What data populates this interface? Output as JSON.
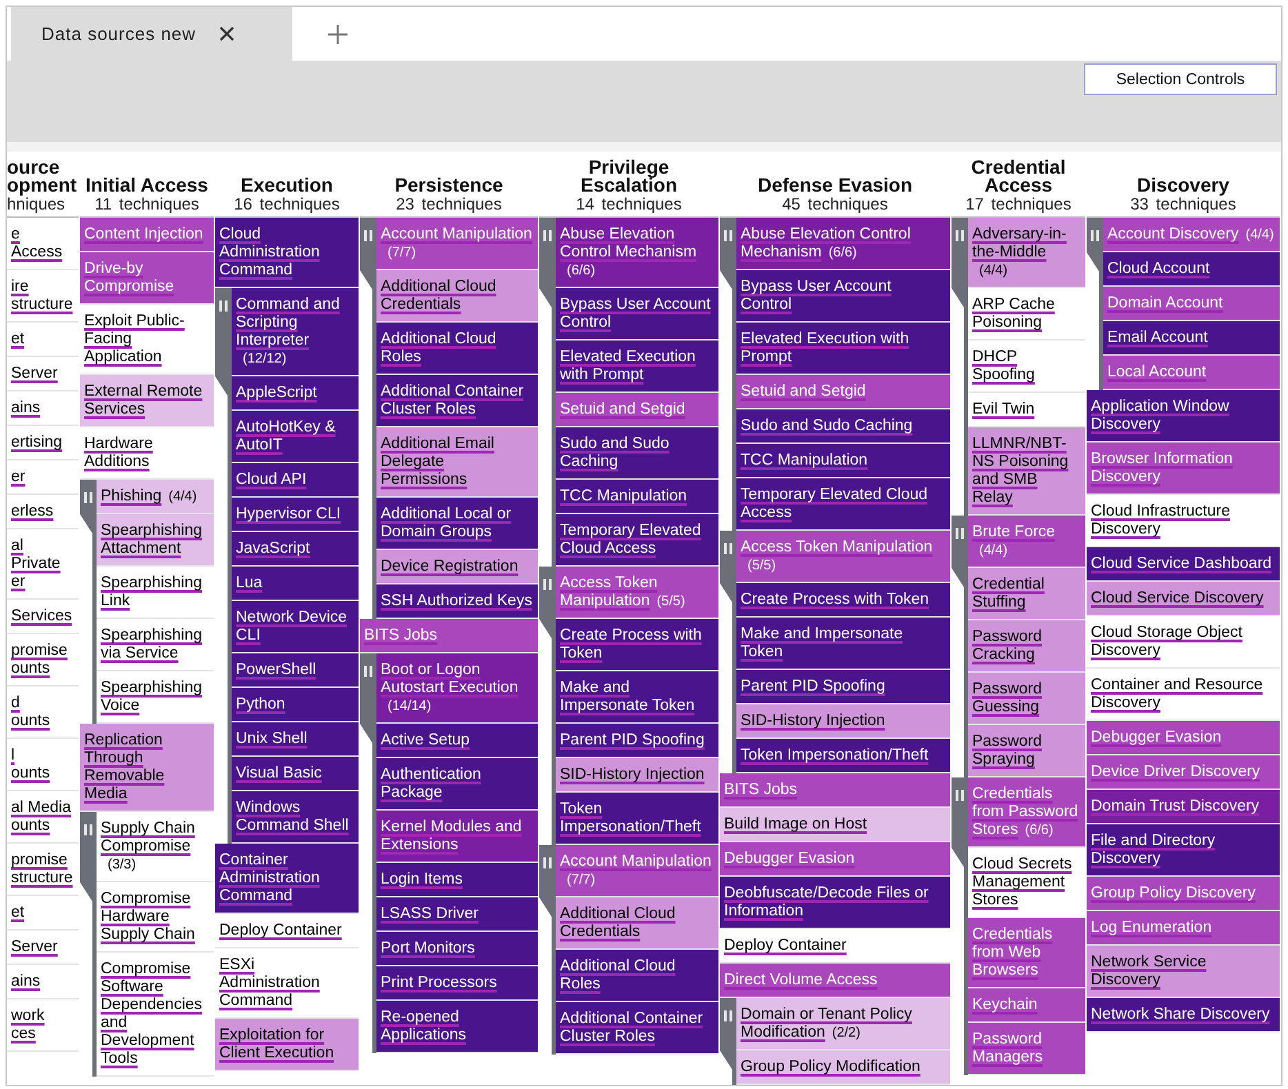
{
  "tab": {
    "title": "Data sources new"
  },
  "toolbar": {
    "button": "Selection Controls"
  },
  "columns": [
    {
      "name": "ource\nopment",
      "count": "hniques",
      "techniques": [
        {
          "name": "e Access",
          "color": "#ffffff"
        },
        {
          "name": "ire\nstructure\n ",
          "color": "#ffffff"
        },
        {
          "name": "et",
          "color": "#ffffff"
        },
        {
          "name": "Server",
          "color": "#ffffff"
        },
        {
          "name": "ains",
          "color": "#ffffff"
        },
        {
          "name": "ertising",
          "color": "#ffffff"
        },
        {
          "name": "er",
          "color": "#ffffff"
        },
        {
          "name": "erless",
          "color": "#ffffff"
        },
        {
          "name": "al Private\ner",
          "color": "#ffffff"
        },
        {
          "name": "Services",
          "color": "#ffffff"
        },
        {
          "name": "promise\nounts\n ",
          "color": "#ffffff"
        },
        {
          "name": "d\nounts",
          "color": "#ffffff"
        },
        {
          "name": "l\nounts",
          "color": "#ffffff"
        },
        {
          "name": "al Media\nounts",
          "color": "#ffffff"
        },
        {
          "name": "promise\nstructure\n ",
          "color": "#ffffff"
        },
        {
          "name": "et",
          "color": "#ffffff"
        },
        {
          "name": "Server",
          "color": "#ffffff"
        },
        {
          "name": "ains",
          "color": "#ffffff"
        },
        {
          "name": "work\nces",
          "color": "#ffffff"
        }
      ]
    },
    {
      "name": "Initial Access",
      "count": "11 techniques",
      "techniques": [
        {
          "name": "Content Injection",
          "color": "#ab47bc"
        },
        {
          "name": "Drive-by Compromise",
          "color": "#ab47bc"
        },
        {
          "name": "Exploit Public-Facing Application",
          "color": "#ffffff"
        },
        {
          "name": "External Remote Services",
          "color": "#e1bee7"
        },
        {
          "name": "Hardware Additions",
          "color": "#ffffff"
        },
        {
          "name": "Phishing",
          "count": "(4/4)",
          "color": "#e1bee7",
          "expanded": true,
          "children": [
            {
              "name": "Spearphishing Attachment",
              "color": "#e1bee7"
            },
            {
              "name": "Spearphishing Link",
              "color": "#ffffff"
            },
            {
              "name": "Spearphishing via Service",
              "color": "#ffffff"
            },
            {
              "name": "Spearphishing Voice",
              "color": "#ffffff"
            }
          ]
        },
        {
          "name": "Replication Through Removable Media",
          "color": "#ce93d8"
        },
        {
          "name": "Supply Chain Compromise",
          "count": "(3/3)",
          "color": "#ffffff",
          "expanded": true,
          "children": [
            {
              "name": "Compromise Hardware Supply Chain",
              "color": "#ffffff"
            },
            {
              "name": "Compromise Software Dependencies and Development Tools",
              "color": "#ffffff"
            }
          ]
        }
      ]
    },
    {
      "name": "Execution",
      "count": "16 techniques",
      "techniques": [
        {
          "name": "Cloud Administration Command",
          "color": "#4a148c"
        },
        {
          "name": "Command and Scripting Interpreter",
          "count": "(12/12)",
          "color": "#4a148c",
          "expanded": true,
          "children": [
            {
              "name": "AppleScript",
              "color": "#4a148c"
            },
            {
              "name": "AutoHotKey & AutoIT",
              "color": "#4a148c"
            },
            {
              "name": "Cloud API",
              "color": "#4a148c"
            },
            {
              "name": "Hypervisor CLI",
              "color": "#4a148c"
            },
            {
              "name": "JavaScript",
              "color": "#4a148c"
            },
            {
              "name": "Lua",
              "color": "#4a148c"
            },
            {
              "name": "Network Device CLI",
              "color": "#4a148c"
            },
            {
              "name": "PowerShell",
              "color": "#4a148c"
            },
            {
              "name": "Python",
              "color": "#4a148c"
            },
            {
              "name": "Unix Shell",
              "color": "#4a148c"
            },
            {
              "name": "Visual Basic",
              "color": "#4a148c"
            },
            {
              "name": "Windows Command Shell",
              "color": "#4a148c"
            }
          ]
        },
        {
          "name": "Container Administration Command",
          "color": "#4a148c"
        },
        {
          "name": "Deploy Container",
          "color": "#ffffff"
        },
        {
          "name": "ESXi Administration Command",
          "color": "#ffffff"
        },
        {
          "name": "Exploitation for Client Execution",
          "color": "#ce93d8"
        }
      ]
    },
    {
      "name": "Persistence",
      "count": "23 techniques",
      "techniques": [
        {
          "name": "Account Manipulation",
          "count": "(7/7)",
          "color": "#ab47bc",
          "expanded": true,
          "children": [
            {
              "name": "Additional Cloud Credentials",
              "color": "#ce93d8"
            },
            {
              "name": "Additional Cloud Roles",
              "color": "#4a148c"
            },
            {
              "name": "Additional Container Cluster Roles",
              "color": "#4a148c"
            },
            {
              "name": "Additional Email Delegate Permissions",
              "color": "#ce93d8"
            },
            {
              "name": "Additional Local or Domain Groups",
              "color": "#4a148c"
            },
            {
              "name": "Device Registration",
              "color": "#ce93d8"
            },
            {
              "name": "SSH Authorized Keys",
              "color": "#4a148c"
            }
          ]
        },
        {
          "name": "BITS Jobs",
          "color": "#ab47bc"
        },
        {
          "name": "Boot or Logon Autostart Execution",
          "count": "(14/14)",
          "color": "#7b1fa2",
          "expanded": true,
          "children": [
            {
              "name": "Active Setup",
              "color": "#4a148c"
            },
            {
              "name": "Authentication Package",
              "color": "#4a148c"
            },
            {
              "name": "Kernel Modules and Extensions",
              "color": "#7b1fa2"
            },
            {
              "name": "Login Items",
              "color": "#4a148c"
            },
            {
              "name": "LSASS Driver",
              "color": "#4a148c"
            },
            {
              "name": "Port Monitors",
              "color": "#4a148c"
            },
            {
              "name": "Print Processors",
              "color": "#4a148c"
            },
            {
              "name": "Re-opened Applications",
              "color": "#4a148c"
            }
          ]
        }
      ]
    },
    {
      "name": "Privilege Escalation",
      "count": "14 techniques",
      "techniques": [
        {
          "name": "Abuse Elevation Control Mechanism",
          "count": "(6/6)",
          "color": "#7b1fa2",
          "expanded": true,
          "children": [
            {
              "name": "Bypass User Account Control",
              "color": "#4a148c"
            },
            {
              "name": "Elevated Execution with Prompt",
              "color": "#4a148c"
            },
            {
              "name": "Setuid and Setgid",
              "color": "#ab47bc"
            },
            {
              "name": "Sudo and Sudo Caching",
              "color": "#4a148c"
            },
            {
              "name": "TCC Manipulation",
              "color": "#4a148c"
            },
            {
              "name": "Temporary Elevated Cloud Access",
              "color": "#4a148c"
            }
          ]
        },
        {
          "name": "Access Token Manipulation",
          "count": "(5/5)",
          "color": "#ab47bc",
          "expanded": true,
          "children": [
            {
              "name": "Create Process with Token",
              "color": "#4a148c"
            },
            {
              "name": "Make and Impersonate Token",
              "color": "#4a148c"
            },
            {
              "name": "Parent PID Spoofing",
              "color": "#4a148c"
            },
            {
              "name": "SID-History Injection",
              "color": "#ce93d8"
            },
            {
              "name": "Token Impersonation/Theft",
              "color": "#4a148c"
            }
          ]
        },
        {
          "name": "Account Manipulation",
          "count": "(7/7)",
          "color": "#ab47bc",
          "expanded": true,
          "children": [
            {
              "name": "Additional Cloud Credentials",
              "color": "#ce93d8"
            },
            {
              "name": "Additional Cloud Roles",
              "color": "#4a148c"
            },
            {
              "name": "Additional Container Cluster Roles",
              "color": "#4a148c"
            }
          ]
        }
      ]
    },
    {
      "name": "Defense Evasion",
      "count": "45 techniques",
      "techniques": [
        {
          "name": "Abuse Elevation Control Mechanism",
          "count": "(6/6)",
          "color": "#7b1fa2",
          "expanded": true,
          "children": [
            {
              "name": "Bypass User Account Control",
              "color": "#4a148c"
            },
            {
              "name": "Elevated Execution with Prompt",
              "color": "#4a148c"
            },
            {
              "name": "Setuid and Setgid",
              "color": "#ab47bc"
            },
            {
              "name": "Sudo and Sudo Caching",
              "color": "#4a148c"
            },
            {
              "name": "TCC Manipulation",
              "color": "#4a148c"
            },
            {
              "name": "Temporary Elevated Cloud Access",
              "color": "#4a148c"
            }
          ]
        },
        {
          "name": "Access Token Manipulation",
          "count": "(5/5)",
          "color": "#ab47bc",
          "expanded": true,
          "children": [
            {
              "name": "Create Process with Token",
              "color": "#4a148c"
            },
            {
              "name": "Make and Impersonate Token",
              "color": "#4a148c"
            },
            {
              "name": "Parent PID Spoofing",
              "color": "#4a148c"
            },
            {
              "name": "SID-History Injection",
              "color": "#ce93d8"
            },
            {
              "name": "Token Impersonation/Theft",
              "color": "#4a148c"
            }
          ]
        },
        {
          "name": "BITS Jobs",
          "color": "#ab47bc"
        },
        {
          "name": "Build Image on Host",
          "color": "#e1bee7"
        },
        {
          "name": "Debugger Evasion",
          "color": "#ab47bc"
        },
        {
          "name": "Deobfuscate/Decode Files or Information",
          "color": "#4a148c"
        },
        {
          "name": "Deploy Container",
          "color": "#ffffff"
        },
        {
          "name": "Direct Volume Access",
          "color": "#ab47bc"
        },
        {
          "name": "Domain or Tenant Policy Modification",
          "count": "(2/2)",
          "color": "#e1bee7",
          "expanded": true,
          "children": [
            {
              "name": "Group Policy Modification",
              "color": "#e1bee7"
            }
          ]
        }
      ]
    },
    {
      "name": "Credential Access",
      "count": "17 techniques",
      "techniques": [
        {
          "name": "Adversary-in-the-Middle",
          "count": "(4/4)",
          "color": "#ce93d8",
          "expanded": true,
          "children": [
            {
              "name": "ARP Cache Poisoning",
              "color": "#ffffff"
            },
            {
              "name": "DHCP Spoofing",
              "color": "#ffffff"
            },
            {
              "name": "Evil Twin",
              "color": "#ffffff"
            },
            {
              "name": "LLMNR/NBT-NS Poisoning and SMB Relay",
              "color": "#ce93d8"
            }
          ]
        },
        {
          "name": "Brute Force",
          "count": "(4/4)",
          "color": "#ab47bc",
          "expanded": true,
          "children": [
            {
              "name": "Credential Stuffing",
              "color": "#ce93d8"
            },
            {
              "name": "Password Cracking",
              "color": "#ce93d8"
            },
            {
              "name": "Password Guessing",
              "color": "#ce93d8"
            },
            {
              "name": "Password Spraying",
              "color": "#ce93d8"
            }
          ]
        },
        {
          "name": "Credentials from Password Stores",
          "count": "(6/6)",
          "color": "#ab47bc",
          "expanded": true,
          "children": [
            {
              "name": "Cloud Secrets Management Stores",
              "color": "#ffffff"
            },
            {
              "name": "Credentials from Web Browsers",
              "color": "#ab47bc"
            },
            {
              "name": "Keychain",
              "color": "#ab47bc"
            },
            {
              "name": "Password Managers",
              "color": "#ab47bc"
            }
          ]
        }
      ]
    },
    {
      "name": "Discovery",
      "count": "33 techniques",
      "techniques": [
        {
          "name": "Account Discovery",
          "count": "(4/4)",
          "color": "#ab47bc",
          "expanded": true,
          "children": [
            {
              "name": "Cloud Account",
              "color": "#4a148c"
            },
            {
              "name": "Domain Account",
              "color": "#ab47bc"
            },
            {
              "name": "Email Account",
              "color": "#4a148c"
            },
            {
              "name": "Local Account",
              "color": "#ab47bc"
            }
          ]
        },
        {
          "name": "Application Window Discovery",
          "color": "#4a148c"
        },
        {
          "name": "Browser Information Discovery",
          "color": "#ab47bc"
        },
        {
          "name": "Cloud Infrastructure Discovery",
          "color": "#ffffff"
        },
        {
          "name": "Cloud Service Dashboard",
          "color": "#4a148c"
        },
        {
          "name": "Cloud Service Discovery",
          "color": "#ce93d8"
        },
        {
          "name": "Cloud Storage Object Discovery",
          "color": "#ffffff"
        },
        {
          "name": "Container and Resource Discovery",
          "color": "#ffffff"
        },
        {
          "name": "Debugger Evasion",
          "color": "#ab47bc"
        },
        {
          "name": "Device Driver Discovery",
          "color": "#ab47bc"
        },
        {
          "name": "Domain Trust Discovery",
          "color": "#7b1fa2"
        },
        {
          "name": "File and Directory Discovery",
          "color": "#4a148c"
        },
        {
          "name": "Group Policy Discovery",
          "color": "#ab47bc"
        },
        {
          "name": "Log Enumeration",
          "color": "#ab47bc"
        },
        {
          "name": "Network Service Discovery",
          "color": "#ce93d8"
        },
        {
          "name": "Network Share Discovery",
          "color": "#4a148c"
        }
      ]
    }
  ]
}
